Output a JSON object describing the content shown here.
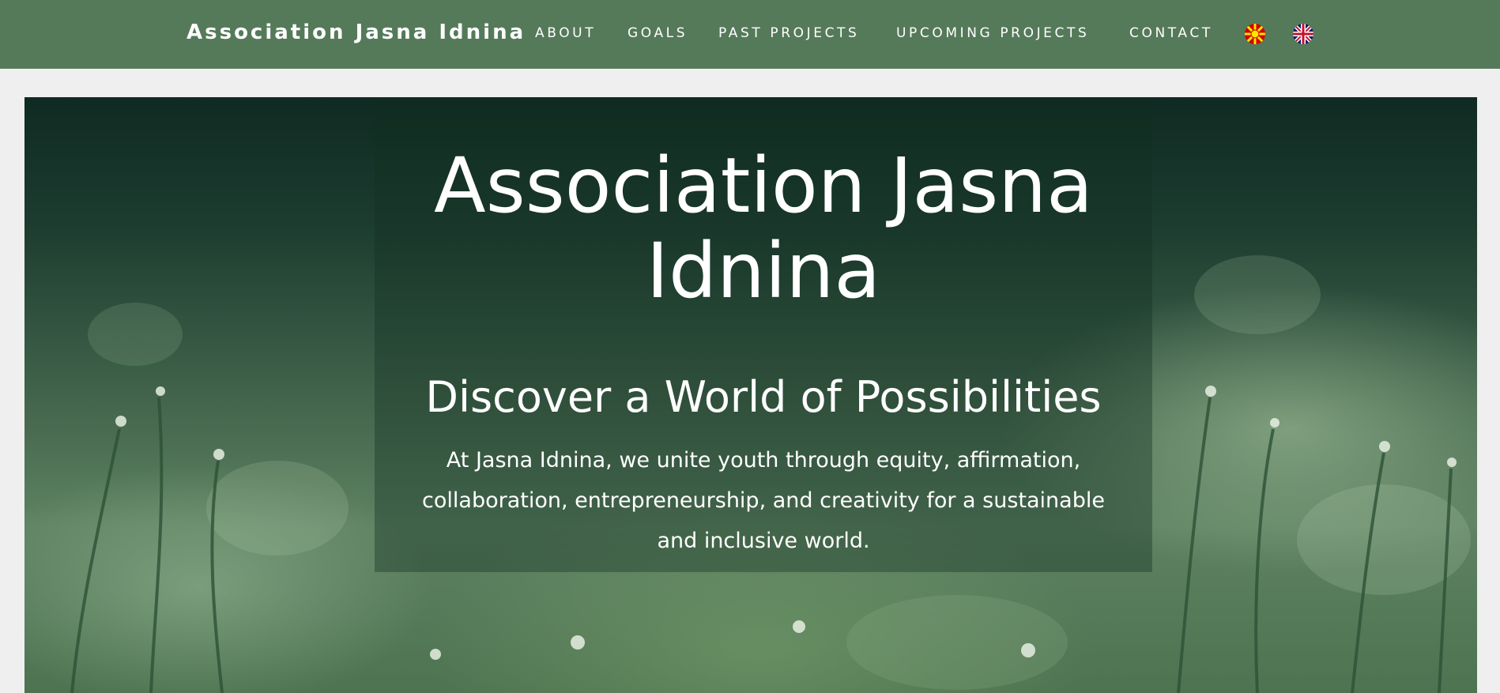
{
  "nav": {
    "brand": "Association Jasna Idnina",
    "links": [
      "ABOUT",
      "GOALS",
      "PAST PROJECTS",
      "UPCOMING PROJECTS",
      "CONTACT"
    ],
    "languages": [
      {
        "icon": "macedonian-flag-icon",
        "colors": [
          "#d20000",
          "#ffe600"
        ]
      },
      {
        "icon": "uk-flag-icon",
        "colors": [
          "#012169",
          "#ffffff",
          "#c8102e"
        ]
      }
    ],
    "background": "#557a5a"
  },
  "hero": {
    "title": "Association Jasna Idnina",
    "subtitle": "Discover a World of Possibilities",
    "description": "At Jasna Idnina, we unite youth through equity, affirmation, collaboration, entrepreneurship, and creativity for a sustainable and inclusive world."
  },
  "colors": {
    "page_background": "#efefef",
    "accent_green": "#557a5a",
    "text": "#ffffff"
  }
}
